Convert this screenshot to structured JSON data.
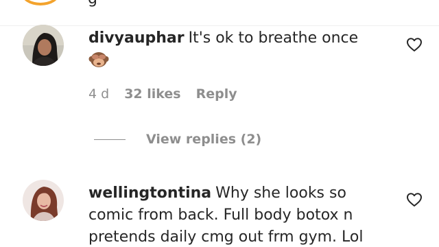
{
  "previous_comment": {
    "fragment": "g"
  },
  "comments": [
    {
      "username": "divyauphar",
      "text": "It's ok to breathe once",
      "emoji": "see-no-evil-monkey-emoji",
      "time": "4 d",
      "likes": "32 likes",
      "reply": "Reply",
      "view_replies": "View replies (2)",
      "avatar": "avatar-woman-dark-hair"
    },
    {
      "username": "wellingtontina",
      "text": "Why she looks so comic from back. Full body botox n pretends daily cmg out frm gym. Lol",
      "avatar": "avatar-woman-red-hair"
    }
  ],
  "icons": {
    "like": "heart-outline-icon"
  },
  "colors": {
    "text": "#262626",
    "secondary": "#8e8e8e",
    "divider": "#efefef",
    "story_ring": "#f3a32d"
  }
}
